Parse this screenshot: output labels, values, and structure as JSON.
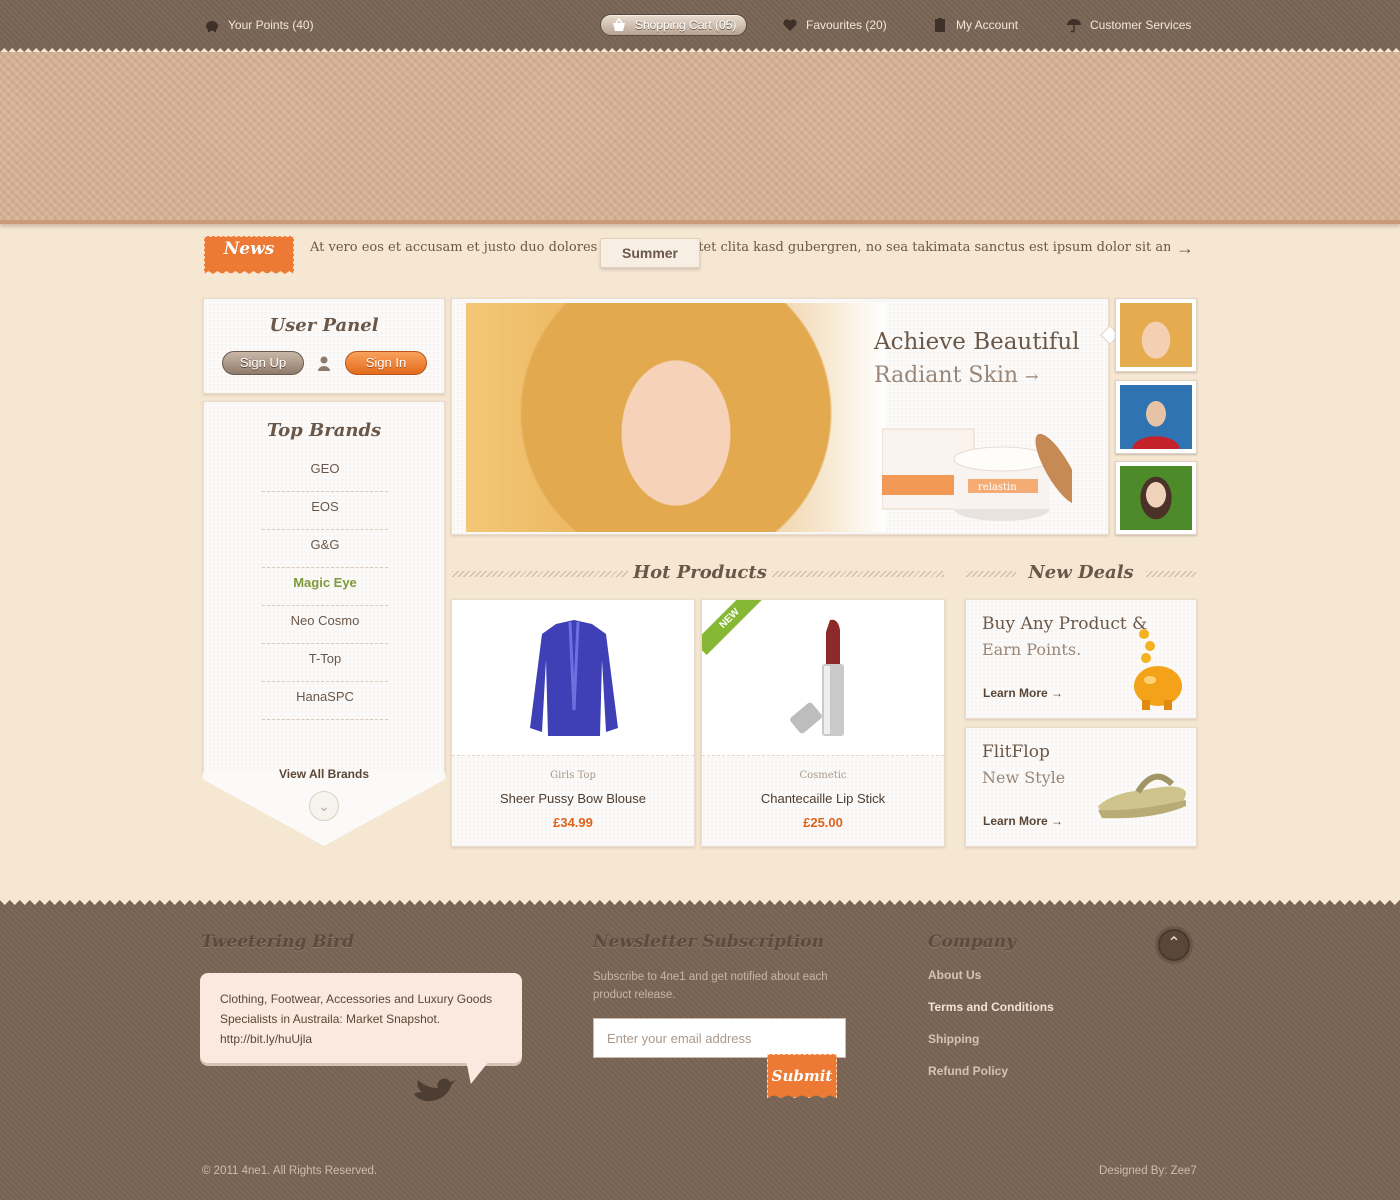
{
  "nav": {
    "points": "Your Points (40)",
    "cart": "Shopping Cart (05)",
    "favourites": "Favourites (20)",
    "account": "My Account",
    "services": "Customer Services"
  },
  "news": {
    "tag": "News",
    "text": "At vero eos et accusam et justo duo dolores et ea rebum. Stet clita kasd gubergren, no sea takimata sanctus est ipsum dolor sit amet..",
    "tab": "Summer",
    "arrow": "→"
  },
  "user_panel": {
    "title": "User Panel",
    "signup": "Sign Up",
    "signin": "Sign In"
  },
  "brands": {
    "title": "Top Brands",
    "items": [
      "GEO",
      "EOS",
      "G&G",
      "Magic Eye",
      "Neo Cosmo",
      "T-Top",
      "HanaSPC"
    ],
    "active": "Magic Eye",
    "view_all": "View All Brands"
  },
  "hero": {
    "title": "Achieve Beautiful",
    "subtitle": "Radiant Skin",
    "arrow": "→",
    "product_label": "relastin"
  },
  "hot_products": {
    "title": "Hot Products",
    "items": [
      {
        "category": "Girls Top",
        "name": "Sheer Pussy Bow Blouse",
        "price": "£34.99"
      },
      {
        "category": "Cosmetic",
        "name": "Chantecaille Lip Stick",
        "price": "£25.00",
        "badge": "NEW"
      }
    ]
  },
  "new_deals": {
    "title": "New Deals",
    "items": [
      {
        "title": "Buy Any Product &",
        "subtitle": "Earn Points.",
        "link": "Learn More →"
      },
      {
        "title": "FlitFlop",
        "subtitle": "New Style",
        "link": "Learn More →"
      }
    ]
  },
  "footer": {
    "tweet_title": "Tweetering Bird",
    "tweet_text_1": "Clothing, Footwear, Accessories and Luxury Goods",
    "tweet_text_2": "Specialists in Austraila: Market Snapshot.",
    "tweet_link": "http://bit.ly/huUjla",
    "newsletter_title": "Newsletter Subscription",
    "newsletter_desc": "Subscribe to 4ne1 and get notified about each product release.",
    "email_placeholder": "Enter your email address",
    "submit": "Submit",
    "company_title": "Company",
    "company_links": [
      "About Us",
      "Terms and Conditions",
      "Shipping",
      "Refund Policy"
    ],
    "copyright": "© 2011 4ne1. All Rights Reserved.",
    "designed_by": "Designed By: Zee7"
  },
  "colors": {
    "accent": "#ec7a34",
    "brown": "#7a6556",
    "green": "#86b836",
    "background": "#f5e7d2"
  }
}
